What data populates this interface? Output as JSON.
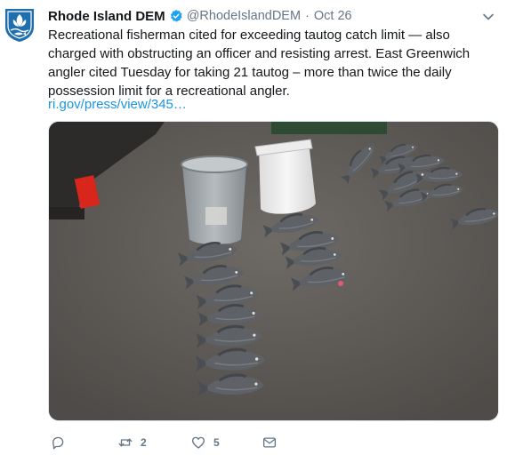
{
  "account": {
    "name": "Rhode Island DEM",
    "handle": "@RhodeIslandDEM",
    "separator": "·",
    "time": "Oct 26",
    "verified": true
  },
  "tweet": {
    "text": "Recreational fisherman cited for exceeding tautog catch limit — also charged with obstructing an officer and resisting arrest. East Greenwich angler cited Tuesday for taking 21 tautog – more than twice the daily possession limit for a recreational angler.",
    "link": "ri.gov/press/view/345…"
  },
  "actions": {
    "reply_count": "",
    "retweet_count": "2",
    "like_count": "5"
  },
  "icons": [
    "dem-logo-icon",
    "verified-badge-icon",
    "chevron-down-icon",
    "reply-icon",
    "retweet-icon",
    "like-icon",
    "direct-message-icon"
  ],
  "colors": {
    "link": "#1b95e0",
    "secondary_text": "#657786",
    "verified": "#1da1f2",
    "logo_blue": "#1f6fae"
  }
}
